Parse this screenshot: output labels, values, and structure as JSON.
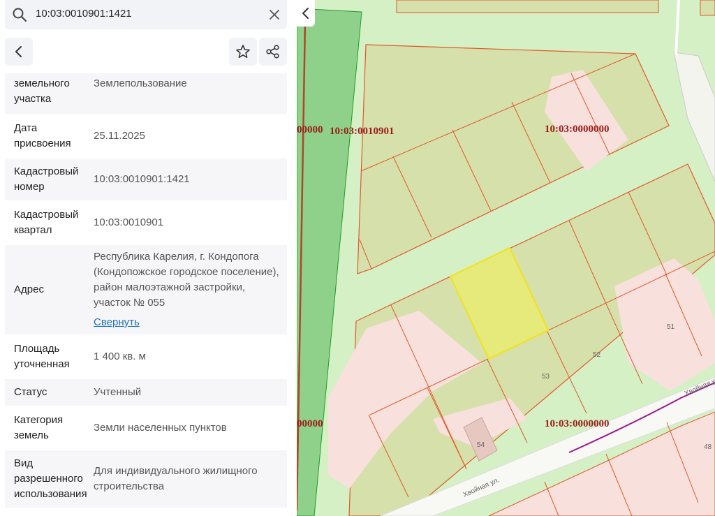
{
  "search": {
    "query": "10:03:0010901:1421"
  },
  "details": [
    {
      "label": "земельного участка",
      "value": "Землепользование"
    },
    {
      "label": "Дата присвоения",
      "value": "25.11.2025"
    },
    {
      "label": "Кадастровый номер",
      "value": "10:03:0010901:1421"
    },
    {
      "label": "Кадастровый квартал",
      "value": "10:03:0010901"
    },
    {
      "label": "Адрес",
      "value": "Республика Карелия, г. Кондопога (Кондопожское городское поселение), район малоэтажной застройки, участок № 055",
      "link": "Свернуть"
    },
    {
      "label": "Площадь уточненная",
      "value": "1 400 кв. м"
    },
    {
      "label": "Статус",
      "value": "Учтенный"
    },
    {
      "label": "Категория земель",
      "value": "Земли населенных пунктов"
    },
    {
      "label": "Вид разрешенного использования",
      "value": "Для индивидуального жилищного строительства"
    }
  ],
  "map": {
    "block_labels": [
      "10:03:0010901",
      "10:03:0000000",
      "10:03:0000000",
      "00000",
      "00000"
    ],
    "parcel_numbers": [
      "51",
      "52",
      "53",
      "54",
      "48"
    ],
    "street_names": [
      "Хвойная ул.",
      "Хвойная ул."
    ]
  },
  "colors": {
    "selected_parcel": "#e6ea7a",
    "boundary": "#e05a2b",
    "forest": "#8fd18a",
    "ground": "#d4f0c4",
    "link": "#1e6fc9"
  }
}
